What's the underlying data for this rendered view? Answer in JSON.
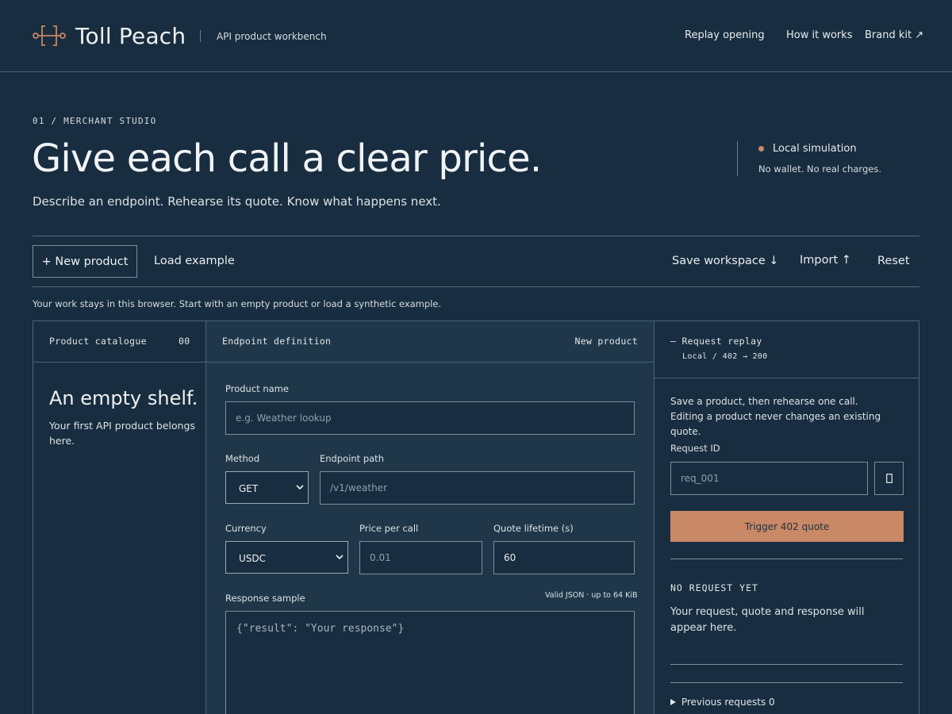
{
  "header": {
    "brand": "Toll Peach",
    "tagline": "API product workbench",
    "nav": [
      "Replay opening",
      "How it works",
      "Brand kit ↗"
    ],
    "logo_icon": "bracket-tag-icon"
  },
  "hero": {
    "eyebrow": "01 / MERCHANT STUDIO",
    "title": "Give each call a clear price.",
    "subtitle": "Describe an endpoint. Rehearse its quote. Know what happens next.",
    "sim_title": "Local simulation",
    "sim_note": "No wallet. No real charges."
  },
  "toolbar": {
    "new_product": "+ New product",
    "load_example": "Load example",
    "save_workspace": "Save workspace ↓",
    "import": "Import ↑",
    "reset": "Reset",
    "helper": "Your work stays in this browser. Start with an empty product or load a synthetic example."
  },
  "catalogue": {
    "label": "Product catalogue",
    "count": "00",
    "empty_title": "An empty shelf.",
    "empty_note": "Your first API product belongs here."
  },
  "endpoint": {
    "label": "Endpoint definition",
    "status": "New product",
    "product_name_label": "Product name",
    "product_name_placeholder": "e.g. Weather lookup",
    "method_label": "Method",
    "method_value": "GET",
    "path_label": "Endpoint path",
    "path_placeholder": "/v1/weather",
    "currency_label": "Currency",
    "currency_value": "USDC",
    "price_label": "Price per call",
    "price_placeholder": "0.01",
    "lifetime_label": "Quote lifetime (s)",
    "lifetime_value": "60",
    "response_label": "Response sample",
    "response_hint": "Valid JSON · up to 64 KiB",
    "response_placeholder": "{\"result\": \"Your response\"}"
  },
  "replay": {
    "label": "– Request replay",
    "sublabel": "Local / 402 → 200",
    "intro": "Save a product, then rehearse one call. Editing a product never changes an existing quote.",
    "request_id_label": "Request ID",
    "request_id_value": "req_001",
    "trigger": "Trigger 402 quote",
    "empty_title": "NO REQUEST YET",
    "empty_note": "Your request, quote and response will appear here.",
    "previous": "Previous requests 0"
  },
  "colors": {
    "background": "#182d3f",
    "panel_mid": "#1f3749",
    "accent": "#c98866",
    "border": "#4d6274"
  }
}
